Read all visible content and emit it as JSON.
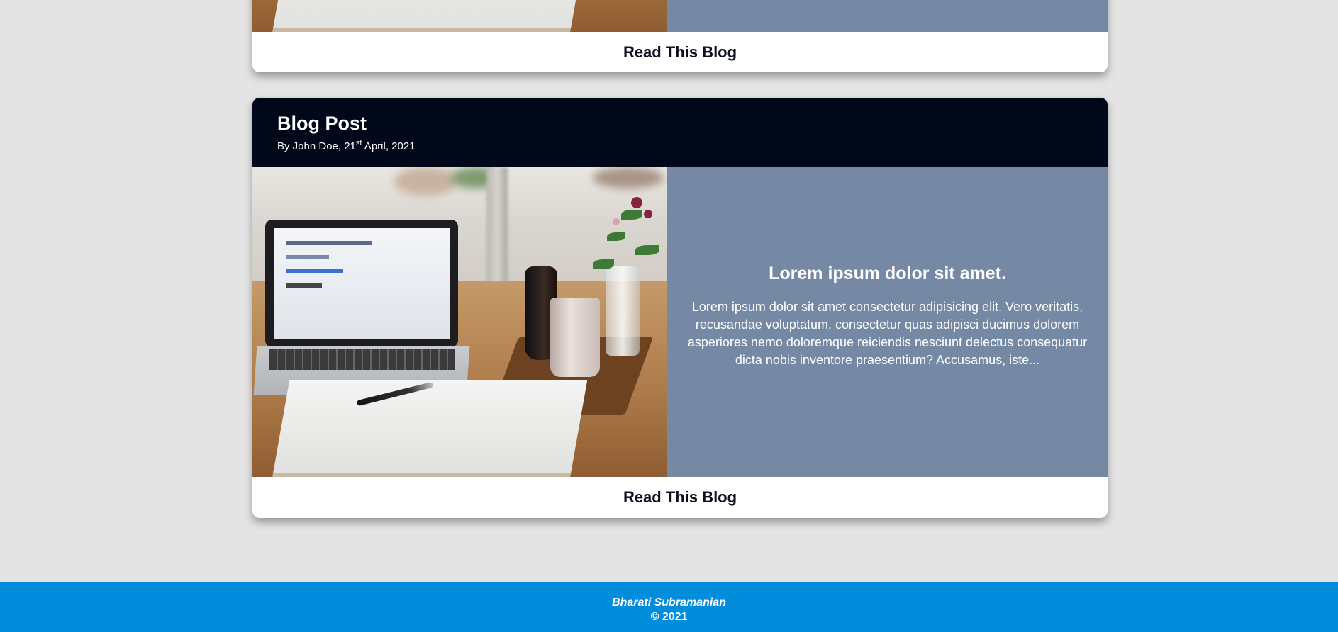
{
  "posts": [
    {
      "read_label": "Read This Blog"
    },
    {
      "title": "Blog Post",
      "byline_prefix": "By John Doe, 21",
      "byline_sup": "st",
      "byline_suffix": " April, 2021",
      "heading": "Lorem ipsum dolor sit amet.",
      "excerpt": "Lorem ipsum dolor sit amet consectetur adipisicing elit. Vero veritatis, recusandae voluptatum, consectetur quas adipisci ducimus dolorem asperiores nemo doloremque reiciendis nesciunt delectus consequatur dicta nobis inventore praesentium? Accusamus, iste...",
      "read_label": "Read This Blog"
    }
  ],
  "footer": {
    "author": "Bharati Subramanian",
    "copyright": "© 2021"
  },
  "colors": {
    "background": "#e4e4e4",
    "card_header": "#010819",
    "card_text_panel": "#7589a4",
    "footer": "#028cdc"
  }
}
